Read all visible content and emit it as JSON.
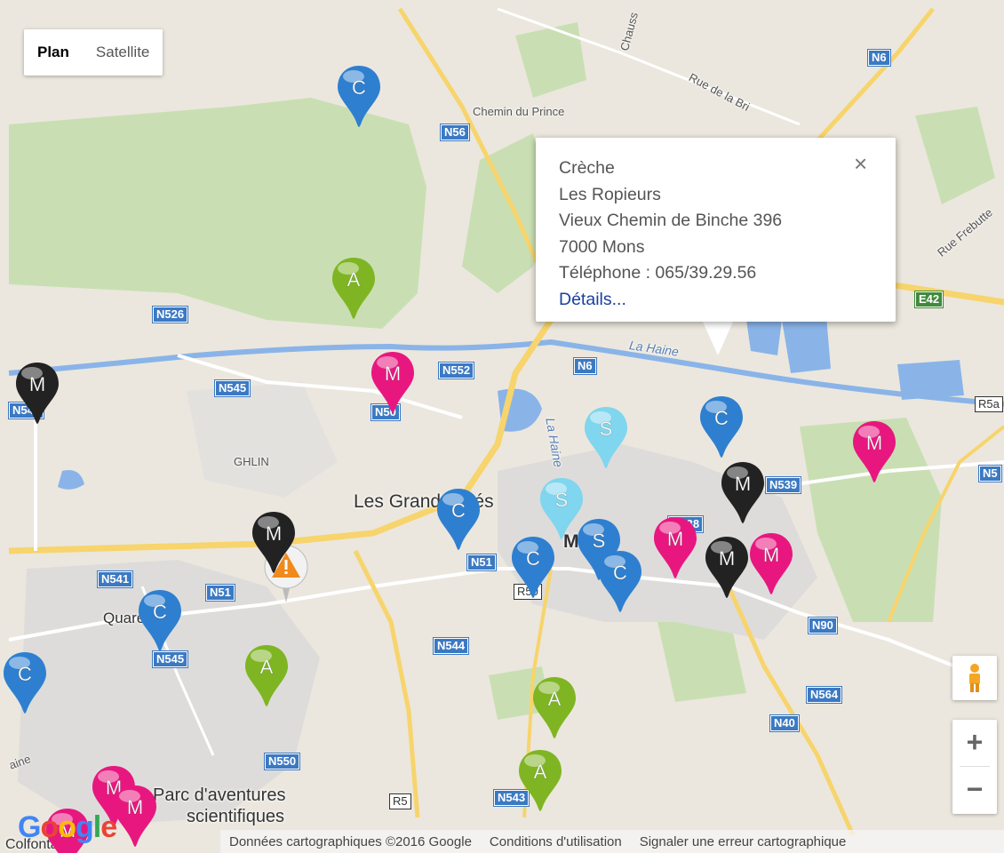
{
  "map_type": {
    "plan": "Plan",
    "satellite": "Satellite"
  },
  "places": {
    "chemin_du_prince": "Chemin du Prince",
    "rue_de_la_bri": "Rue de la Bri",
    "chauss": "Chauss",
    "rue_frebutte": "Rue Frebutte",
    "ghlin": "GHLIN",
    "les_grands_pres": "Les Grands Prés",
    "mons": "Mons",
    "quaregnon": "Quaregnon",
    "la_haine_1": "La Haine",
    "la_haine_2": "La Haine",
    "parc1": "Parc d'aventures",
    "parc2": "scientifiques",
    "jemappes_partial": "ain",
    "haine_partial": "aine",
    "colfontaine": "Colfontaine"
  },
  "roads": {
    "n6_top": "N6",
    "n56": "N56",
    "e42": "E42",
    "n526": "N526",
    "n552": "N552",
    "n6_mid": "N6",
    "n545_top": "N545",
    "n50": "N50",
    "n541_left": "N541",
    "r5_right": "R5a",
    "n539": "N539",
    "n5_right": "N5",
    "n538": "N538",
    "n51_center": "N51",
    "r50": "R50",
    "n541": "N541",
    "n51_left": "N51",
    "n90": "N90",
    "n545_bottom": "N545",
    "n544": "N544",
    "n564": "N564",
    "n40": "N40",
    "n550": "N550",
    "r5": "R5",
    "n543": "N543"
  },
  "markers": [
    {
      "letter": "C",
      "color": "#2e7fd0"
    },
    {
      "letter": "A",
      "color": "#7fb523"
    },
    {
      "letter": "M",
      "color": "#e8177f"
    },
    {
      "letter": "M",
      "color": "#222222"
    },
    {
      "letter": "C",
      "color": "#2e7fd0"
    },
    {
      "letter": "S",
      "color": "#7fd6ee"
    },
    {
      "letter": "M",
      "color": "#e8177f"
    },
    {
      "letter": "M",
      "color": "#222222"
    },
    {
      "letter": "C",
      "color": "#2e7fd0"
    },
    {
      "letter": "S",
      "color": "#7fd6ee"
    },
    {
      "letter": "M",
      "color": "#222222"
    },
    {
      "letter": "S",
      "color": "#2e7fd0"
    },
    {
      "letter": "M",
      "color": "#e8177f"
    },
    {
      "letter": "C",
      "color": "#2e7fd0"
    },
    {
      "letter": "C",
      "color": "#2e7fd0"
    },
    {
      "letter": "M",
      "color": "#222222"
    },
    {
      "letter": "M",
      "color": "#e8177f"
    },
    {
      "letter": "C",
      "color": "#2e7fd0"
    },
    {
      "letter": "A",
      "color": "#7fb523"
    },
    {
      "letter": "C",
      "color": "#2e7fd0"
    },
    {
      "letter": "A",
      "color": "#7fb523"
    },
    {
      "letter": "A",
      "color": "#7fb523"
    },
    {
      "letter": "M",
      "color": "#e8177f"
    },
    {
      "letter": "M",
      "color": "#e8177f"
    },
    {
      "letter": "M",
      "color": "#e8177f"
    }
  ],
  "info_window": {
    "type": "Crèche",
    "name": "Les Ropieurs",
    "address": "Vieux Chemin de Binche 396",
    "city": "7000 Mons",
    "phone_label": "Téléphone :",
    "phone": "065/39.29.56",
    "details": "Détails...",
    "close": "×"
  },
  "controls": {
    "zoom_in": "+",
    "zoom_out": "−"
  },
  "footer": {
    "data": "Données cartographiques ©2016 Google",
    "terms": "Conditions d'utilisation",
    "report": "Signaler une erreur cartographique"
  },
  "logo": "Google",
  "colors": {
    "land": "#ebe7de",
    "green": "#c9dfb3",
    "water": "#8ab4e8",
    "urban": "#dcdcdc",
    "road": "#f7d46c",
    "shield": "#3b79c3"
  }
}
